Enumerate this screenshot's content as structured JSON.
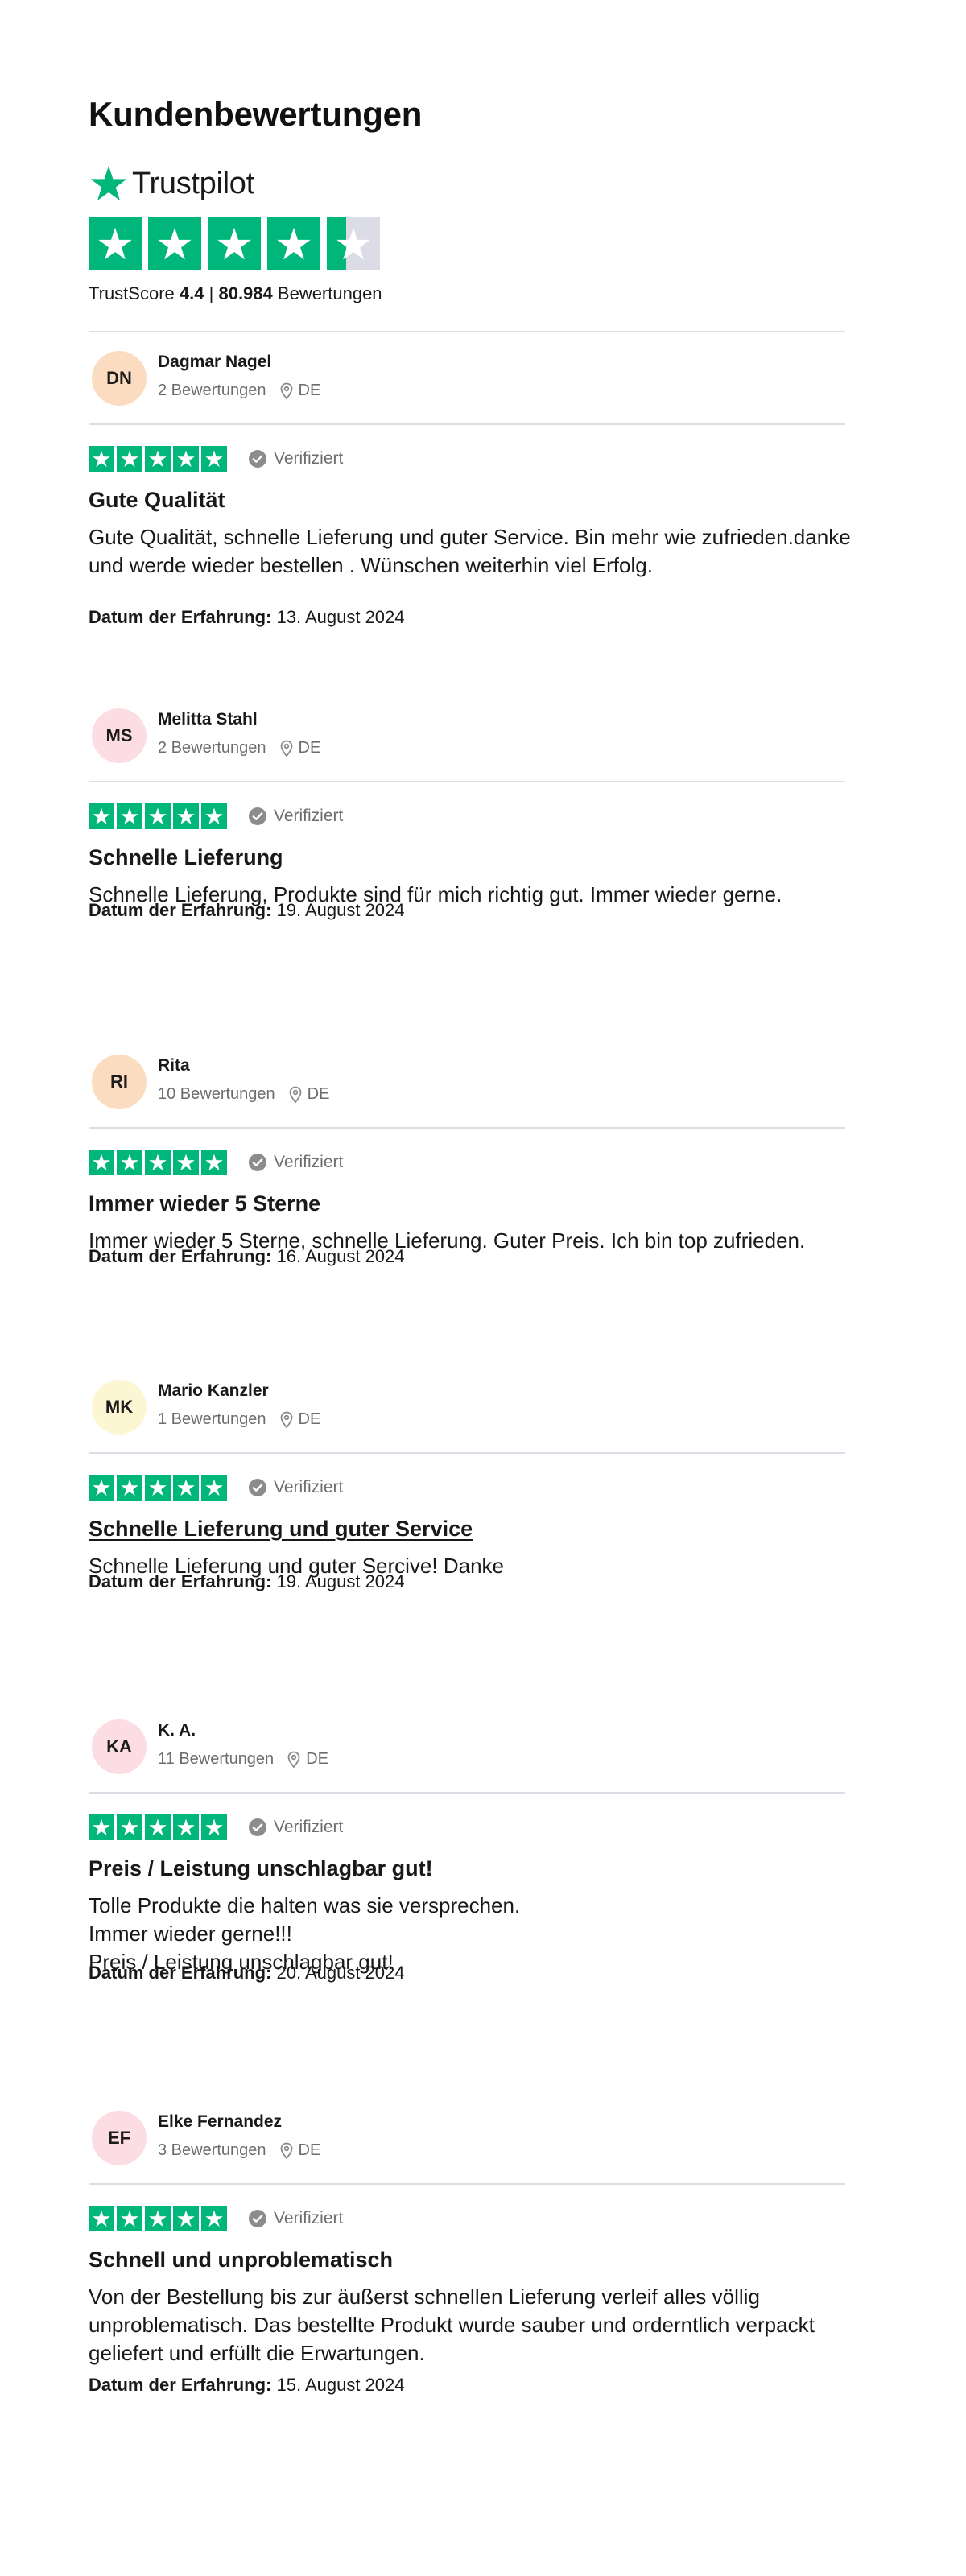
{
  "page": {
    "heading": "Kundenbewertungen"
  },
  "trustpilot": {
    "brand": "Trustpilot",
    "brand_color": "#00b67a",
    "trustscore_label": "TrustScore",
    "trustscore_value": "4.4",
    "separator": "|",
    "review_count": "80.984",
    "review_count_label": "Bewertungen",
    "star_rating": 4.4
  },
  "labels": {
    "verified": "Verifiziert",
    "date_label": "Datum der Erfahrung:",
    "country": "DE"
  },
  "reviews": [
    {
      "initials": "DN",
      "avatar_color": "#fbdcc0",
      "name": "Dagmar Nagel",
      "review_count": "2 Bewertungen",
      "country": "DE",
      "stars": 5,
      "verified": "Verifiziert",
      "title": "Gute Qualität",
      "body": "Gute Qualität, schnelle Lieferung und guter Service. Bin mehr wie zufrieden.danke\nund werde wieder bestellen . Wünschen weiterhin viel Erfolg.",
      "date_label": "Datum der Erfahrung:",
      "date": "13. August 2024"
    },
    {
      "initials": "MS",
      "avatar_color": "#fcdde4",
      "name": "Melitta Stahl",
      "review_count": "2 Bewertungen",
      "country": "DE",
      "stars": 5,
      "verified": "Verifiziert",
      "title": "Schnelle Lieferung",
      "body": "Schnelle Lieferung, Produkte sind für mich richtig gut. Immer wieder gerne.",
      "date_label": "Datum der Erfahrung:",
      "date": "19. August 2024"
    },
    {
      "initials": "RI",
      "avatar_color": "#fbdcc0",
      "name": "Rita",
      "review_count": "10 Bewertungen",
      "country": "DE",
      "stars": 5,
      "verified": "Verifiziert",
      "title": "Immer wieder 5 Sterne",
      "body": "Immer wieder 5 Sterne, schnelle Lieferung. Guter Preis. Ich bin top zufrieden.",
      "date_label": "Datum der Erfahrung:",
      "date": "16. August 2024"
    },
    {
      "initials": "MK",
      "avatar_color": "#fdf6d3",
      "name": "Mario Kanzler",
      "review_count": "1 Bewertungen",
      "country": "DE",
      "stars": 5,
      "verified": "Verifiziert",
      "title": "Schnelle Lieferung und guter Service",
      "title_link": true,
      "body": "Schnelle Lieferung und guter Sercive! Danke",
      "date_label": "Datum der Erfahrung:",
      "date": "19. August 2024"
    },
    {
      "initials": "KA",
      "avatar_color": "#fcdde4",
      "name": "K. A.",
      "review_count": "11 Bewertungen",
      "country": "DE",
      "stars": 5,
      "verified": "Verifiziert",
      "title": "Preis / Leistung unschlagbar gut!",
      "body": "Tolle Produkte die halten was sie versprechen.\nImmer wieder gerne!!!\nPreis / Leistung unschlagbar gut!",
      "date_label": "Datum der Erfahrung:",
      "date": "20. August 2024"
    },
    {
      "initials": "EF",
      "avatar_color": "#fcdde4",
      "name": "Elke Fernandez",
      "review_count": "3 Bewertungen",
      "country": "DE",
      "stars": 5,
      "verified": "Verifiziert",
      "title": "Schnell und unproblematisch",
      "body": "Von der Bestellung bis zur äußerst schnellen Lieferung verleif alles völlig\nunproblematisch. Das bestellte Produkt wurde sauber und orderntlich verpackt\ngeliefert und erfüllt die Erwartungen.",
      "date_label": "Datum der Erfahrung:",
      "date": "15. August 2024"
    }
  ]
}
